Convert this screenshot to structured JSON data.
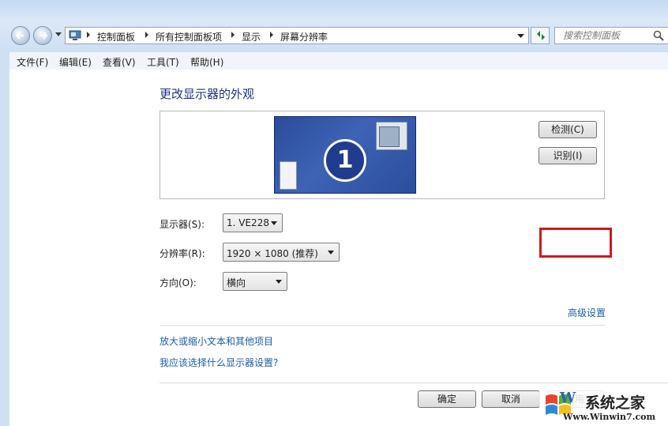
{
  "window": {
    "breadcrumb": [
      "控制面板",
      "所有控制面板项",
      "显示",
      "屏幕分辨率"
    ],
    "search_placeholder": "搜索控制面板"
  },
  "menu": [
    "文件(F)",
    "编辑(E)",
    "查看(V)",
    "工具(T)",
    "帮助(H)"
  ],
  "main": {
    "heading": "更改显示器的外观",
    "monitor_number": "1",
    "detect_button": "检测(C)",
    "identify_button": "识别(I)",
    "display_label": "显示器(S):",
    "display_value": "1. VE228",
    "resolution_label": "分辨率(R):",
    "resolution_value": "1920 × 1080 (推荐)",
    "orientation_label": "方向(O):",
    "orientation_value": "横向",
    "advanced_link": "高级设置",
    "link_text_size": "放大或缩小文本和其他项目",
    "link_which_setting": "我应该选择什么显示器设置?",
    "ok_button": "确定",
    "cancel_button": "取消",
    "apply_button": "应用"
  },
  "watermark": {
    "title": "系统之家",
    "url": "Www.Winwin7.com",
    "logo_letter": "W"
  },
  "colors": {
    "highlight": "#d4161c",
    "link": "#1a5ea8",
    "heading": "#1e3287"
  }
}
